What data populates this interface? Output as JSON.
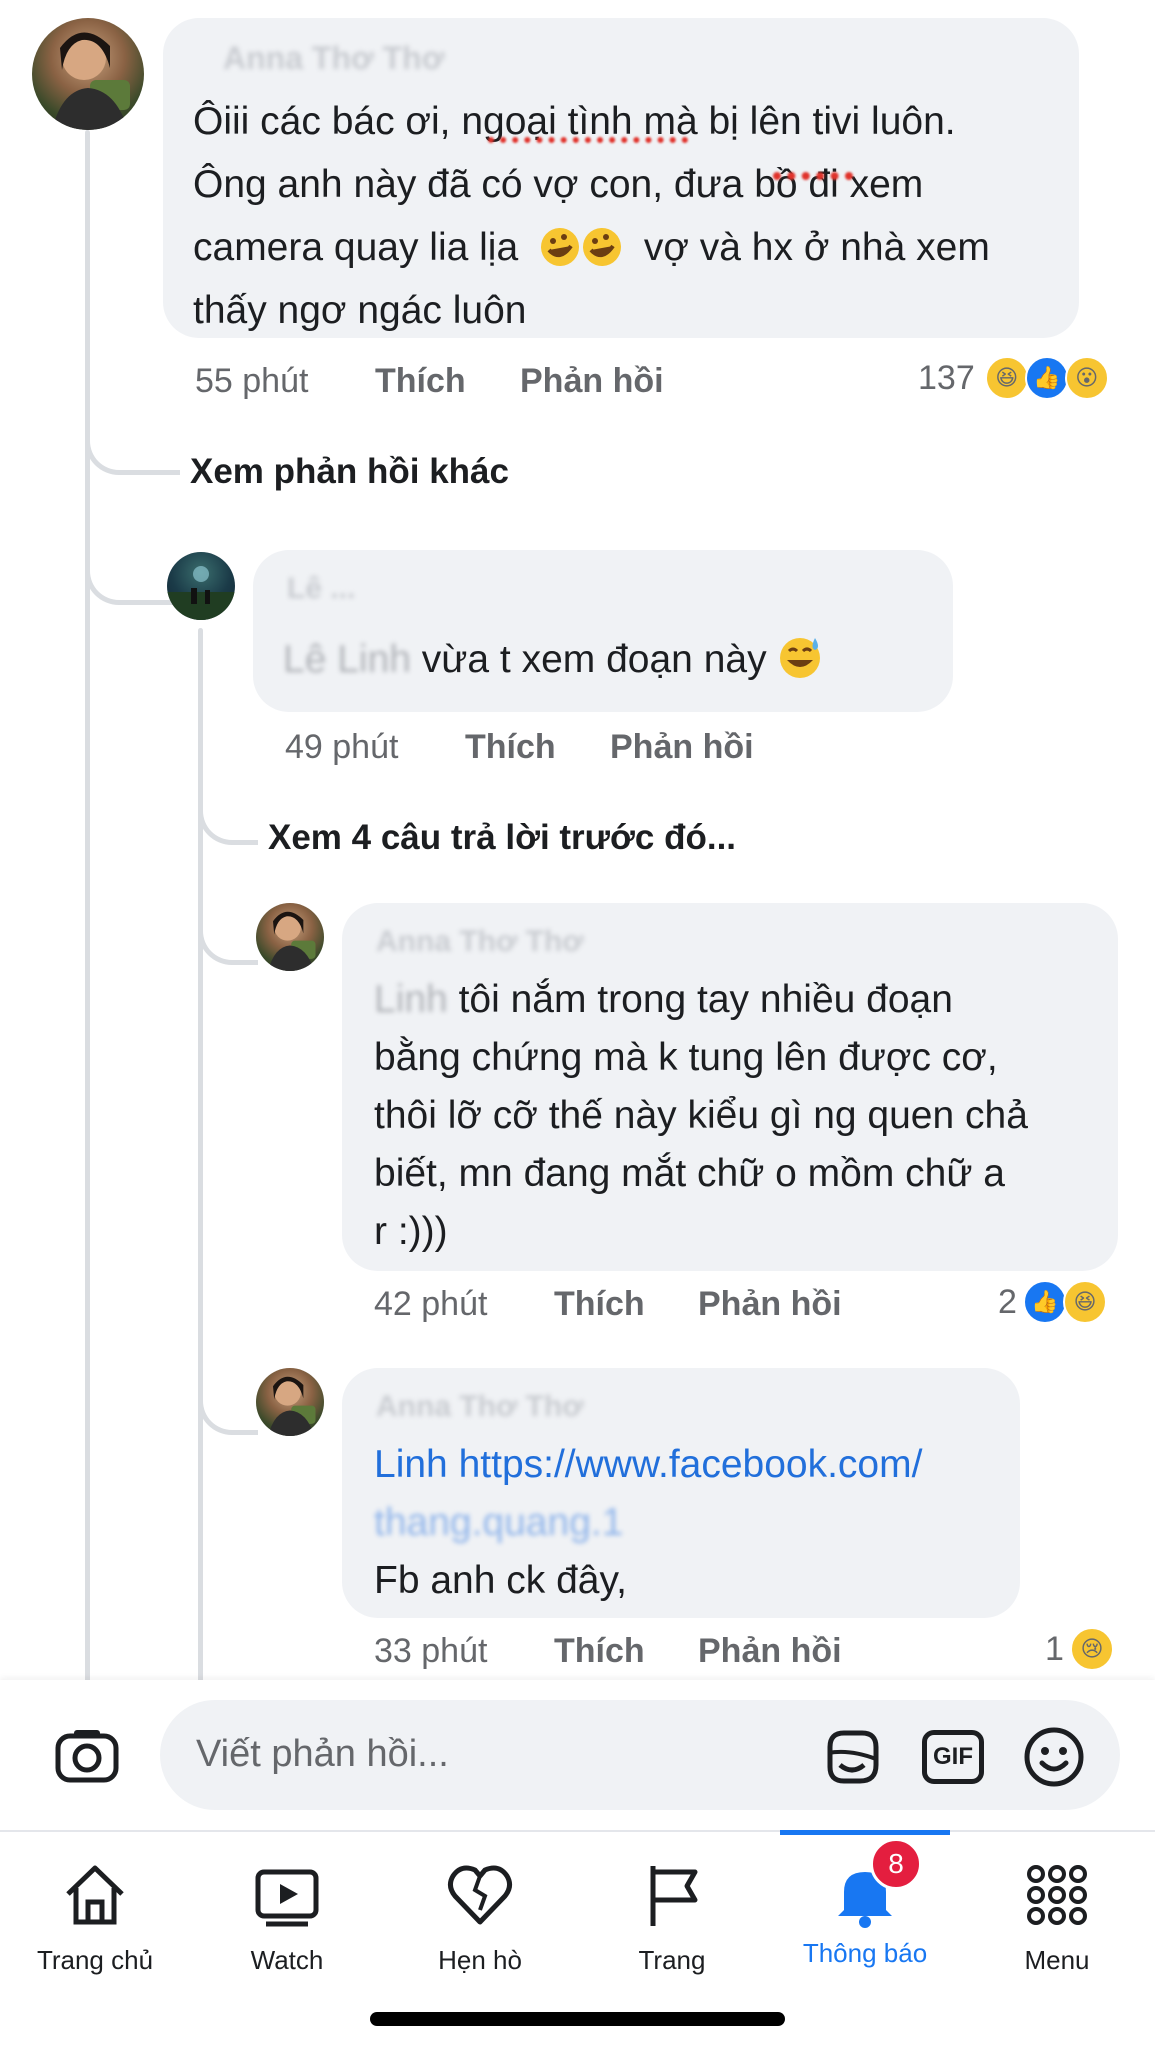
{
  "comments": [
    {
      "author": "Anna Thơ Thơ",
      "text_lines": [
        "Ôiii các bác ơi, ngoại tình mà bị lên tivi luôn.",
        "Ông anh này đã có vợ con, đưa bồ đi xem",
        "camera quay lia lịa",
        "vợ và hx ở nhà xem",
        "thấy ngơ ngác luôn"
      ],
      "time": "55 phút",
      "like": "Thích",
      "reply": "Phản hồi",
      "reaction_count": "137"
    },
    {
      "author": "Lê ...",
      "tag": "Lê Linh",
      "text": "vừa t xem đoạn này",
      "time": "49 phút",
      "like": "Thích",
      "reply": "Phản hồi"
    },
    {
      "author": "Anna Thơ Thơ",
      "tag": "Linh",
      "text_lines": [
        "tôi nắm trong tay nhiều đoạn",
        "bằng chứng mà k tung lên được cơ,",
        "thôi lỡ cỡ thế này kiểu gì ng quen chả",
        "biết, mn đang mắt chữ o mồm chữ a",
        "r :)))"
      ],
      "time": "42 phút",
      "like": "Thích",
      "reply": "Phản hồi",
      "reaction_count": "2"
    },
    {
      "author": "Anna Thơ Thơ",
      "link_prefix": "Linh",
      "link": "https://www.facebook.com/",
      "link_blur": "thang.quang.1",
      "text": "Fb anh ck đây,",
      "time": "33 phút",
      "like": "Thích",
      "reply": "Phản hồi",
      "reaction_count": "1"
    }
  ],
  "more_replies": "Xem phản hồi khác",
  "previous_replies": "Xem 4 câu trả lời trước đó...",
  "composer": {
    "placeholder": "Viết phản hồi...",
    "gif_label": "GIF"
  },
  "nav": {
    "home": "Trang chủ",
    "watch": "Watch",
    "dating": "Hẹn hò",
    "pages": "Trang",
    "notifications": "Thông báo",
    "notifications_badge": "8",
    "menu": "Menu"
  },
  "colors": {
    "bubble": "#f0f2f5",
    "active": "#1877f2",
    "badge": "#e41e3f",
    "muted": "#65676b"
  }
}
